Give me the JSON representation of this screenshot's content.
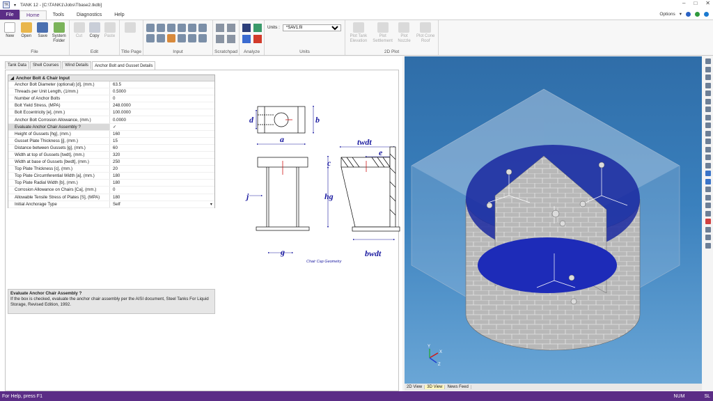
{
  "window": {
    "title": "TANK 12 - [C:\\TANK1\\Jobs\\Tbase2.tkdb]",
    "app_icon_text": "TK"
  },
  "menu": {
    "file": "File",
    "tabs": [
      "Home",
      "Tools",
      "Diagnostics",
      "Help"
    ],
    "options": "Options"
  },
  "ribbon": {
    "file_group": {
      "label": "File",
      "buttons": [
        "New",
        "Open",
        "Save",
        "System Folder"
      ]
    },
    "edit_group": {
      "label": "Edit",
      "buttons": [
        "Cut",
        "Copy",
        "Paste"
      ]
    },
    "title_page_group": {
      "label": "Title Page"
    },
    "input_group": {
      "label": "Input"
    },
    "scratchpad_group": {
      "label": "Scratchpad"
    },
    "analyze_group": {
      "label": "Analyze"
    },
    "units_group": {
      "label": "Units",
      "field_label": "Units :",
      "selected": "*SAV1.fil"
    },
    "plot_group": {
      "label": "2D Plot",
      "buttons": [
        "Plot Tank Elevation",
        "Plot Settlement",
        "Plot Nozzle",
        "Plot Cone Roof"
      ]
    }
  },
  "tabs": [
    "Tank Data",
    "Shell Courses",
    "Wind Details",
    "Anchor Bolt and Gusset Details"
  ],
  "property_grid": {
    "header": "Anchor Bolt & Chair Input",
    "rows": [
      {
        "label": "Anchor Bolt Diameter (optional) [d], (mm.)",
        "value": "63.5"
      },
      {
        "label": "Threads per Unit Length, (1/mm.)",
        "value": "0.5000"
      },
      {
        "label": "Number of Anchor Bolts",
        "value": "0"
      },
      {
        "label": "Bolt Yield Stress, (MPA)",
        "value": "248.0000"
      },
      {
        "label": "Bolt Eccentricity [e], (mm.)",
        "value": "100.0000"
      },
      {
        "label": "Anchor Bolt Corrosion Allowance, (mm.)",
        "value": "0.0000"
      },
      {
        "label": "Evaluate Anchor Chair Assembly ?",
        "value": "✓"
      },
      {
        "label": "Height of Gussets [hg], (mm.)",
        "value": "160"
      },
      {
        "label": "Gusset Plate Thickness [j], (mm.)",
        "value": "15"
      },
      {
        "label": "Distance between Gussets [g], (mm.)",
        "value": "60"
      },
      {
        "label": "Width at top of Gussets [twdt], (mm.)",
        "value": "320"
      },
      {
        "label": "Width at base of Gussets [bwdt], (mm.)",
        "value": "250"
      },
      {
        "label": "Top Plate Thickness [c], (mm.)",
        "value": "20"
      },
      {
        "label": "Top Plate Circumferential Width [a], (mm.)",
        "value": "180"
      },
      {
        "label": "Top Plate Radial Width [b], (mm.)",
        "value": "180"
      },
      {
        "label": "Corrosion Allowance on Chairs [Ca], (mm.)",
        "value": "0"
      },
      {
        "label": "Allowable Tensile Stress of Plates [S], (MPA)",
        "value": "180"
      },
      {
        "label": "Initial Anchorage Type",
        "value": "Self"
      }
    ]
  },
  "description": {
    "title": "Evaluate Anchor Chair Assembly ?",
    "text": "If the box is checked, evaluate the anchor chair assembly per the AISI document, Steel Tanks For Liquid Storage, Revised Edition, 1992."
  },
  "diagram": {
    "labels": {
      "d": "d",
      "b": "b",
      "a": "a",
      "c": "c",
      "hg": "hg",
      "j": "j",
      "g": "g",
      "twdt": "twdt",
      "e": "e",
      "bwdt": "bwdt"
    },
    "caption": "Chair Cap Geometry"
  },
  "viewport": {
    "tabs": [
      "2D View",
      "3D View",
      "News Feed"
    ],
    "active_tab": "3D View",
    "axes": {
      "x": "X",
      "y": "Y",
      "z": "Z"
    }
  },
  "status": {
    "left": "For Help, press F1",
    "num": "NUM",
    "sl": "SL"
  },
  "colors": {
    "accent": "#5b2d86",
    "viewport_bg": "#3a80bd",
    "dimension_blue": "#1a1aa0",
    "dimension_red": "#d01818"
  }
}
